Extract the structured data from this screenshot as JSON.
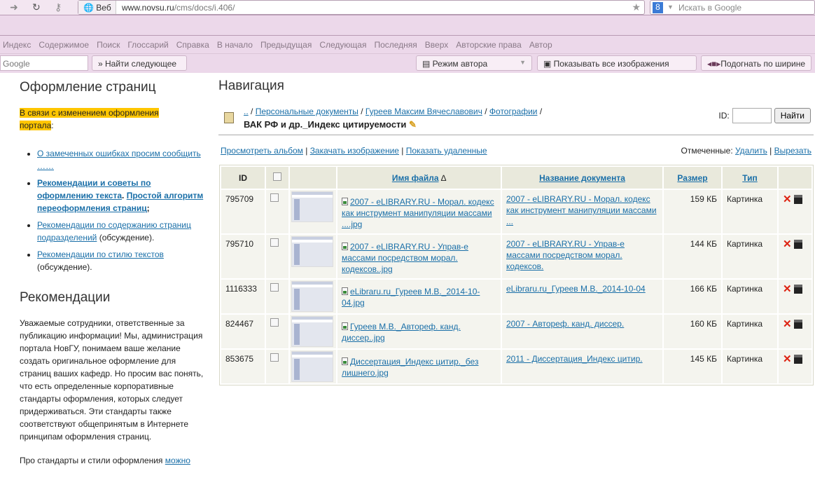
{
  "browser": {
    "web_tag": "Веб",
    "url_domain": "www.novsu.ru",
    "url_path": "/cms/docs/i.406/",
    "search_placeholder": "Искать в Google",
    "menu": [
      "Индекс",
      "Содержимое",
      "Поиск",
      "Глоссарий",
      "Справка",
      "В начало",
      "Предыдущая",
      "Следующая",
      "Последняя",
      "Вверх",
      "Авторские права",
      "Автор"
    ],
    "find_field": "Google",
    "find_next": "Найти следующее",
    "author_mode": "Режим автора",
    "show_images": "Показывать все изображения",
    "fit_width": "Подогнать по ширине"
  },
  "left": {
    "title1": "Оформление страниц",
    "notice": "В связи с изменением оформления портала",
    "notice_tail": ":",
    "links": {
      "errors": "О замеченных ошибках просим сообщить ……",
      "tips": "Рекомендации и советы по оформлению текста",
      "algo": "Простой алгоритм переоформления страниц",
      "content": "Рекомендации по содержанию страниц подразделений",
      "style": "Рекомендации по стилю текстов",
      "discussion": "(обсуждение)."
    },
    "title2": "Рекомендации",
    "para1": "Уважаемые сотрудники, ответственные за публикацию информации! Мы, администрация портала НовГУ, понимаем ваше желание создать оригинальное оформление для страниц ваших кафедр. Но просим вас понять, что есть определенные корпоративные стандарты оформления, которых следует придерживаться. Эти стандарты также соответствуют общепринятым в Интернете принципам оформления страниц.",
    "para2": "Про стандарты и стили оформления",
    "para2_link": "можно"
  },
  "main": {
    "title": "Навигация",
    "crumbs": [
      "..",
      "Персональные документы",
      "Гуреев Максим Вячеславович",
      "Фотографии"
    ],
    "folder": "ВАК РФ и др._Индекс цитируемости",
    "id_label": "ID:",
    "find": "Найти",
    "view_album": "Просмотреть альбом",
    "upload": "Закачать изображение",
    "show_deleted": "Показать удаленные",
    "marked": "Отмеченные:",
    "delete": "Удалить",
    "cut": "Вырезать",
    "headers": {
      "id": "ID",
      "filename": "Имя файла",
      "sort": "∆",
      "docname": "Название документа",
      "size": "Размер",
      "type": "Тип"
    },
    "rows": [
      {
        "id": "795709",
        "file": "2007 - eLIBRARY.RU - Морал. кодекс как инструмент манипуляции массами ....jpg",
        "doc": "2007 - eLIBRARY.RU - Морал. кодекс как инструмент манипуляции массами ...",
        "size": "159 КБ",
        "type": "Картинка"
      },
      {
        "id": "795710",
        "file": "2007 - eLIBRARY.RU - Управ-е массами посредством морал. кодексов..jpg",
        "doc": "2007 - eLIBRARY.RU - Управ-е массами посредством морал. кодексов.",
        "size": "144 КБ",
        "type": "Картинка"
      },
      {
        "id": "1116333",
        "file": "eLibraru.ru_Гуреев М.В._2014-10-04.jpg",
        "doc": "eLibraru.ru_Гуреев М.В._2014-10-04",
        "size": "166 КБ",
        "type": "Картинка"
      },
      {
        "id": "824467",
        "file": "Гуреев М.В._Автореф. канд. диссер..jpg",
        "doc": "2007 - Автореф. канд. диссер.",
        "size": "160 КБ",
        "type": "Картинка"
      },
      {
        "id": "853675",
        "file": "Диссертация_Индекс цитир._без лишнего.jpg",
        "doc": "2011 - Диссертация_Индекс цитир.",
        "size": "145 КБ",
        "type": "Картинка"
      }
    ]
  }
}
